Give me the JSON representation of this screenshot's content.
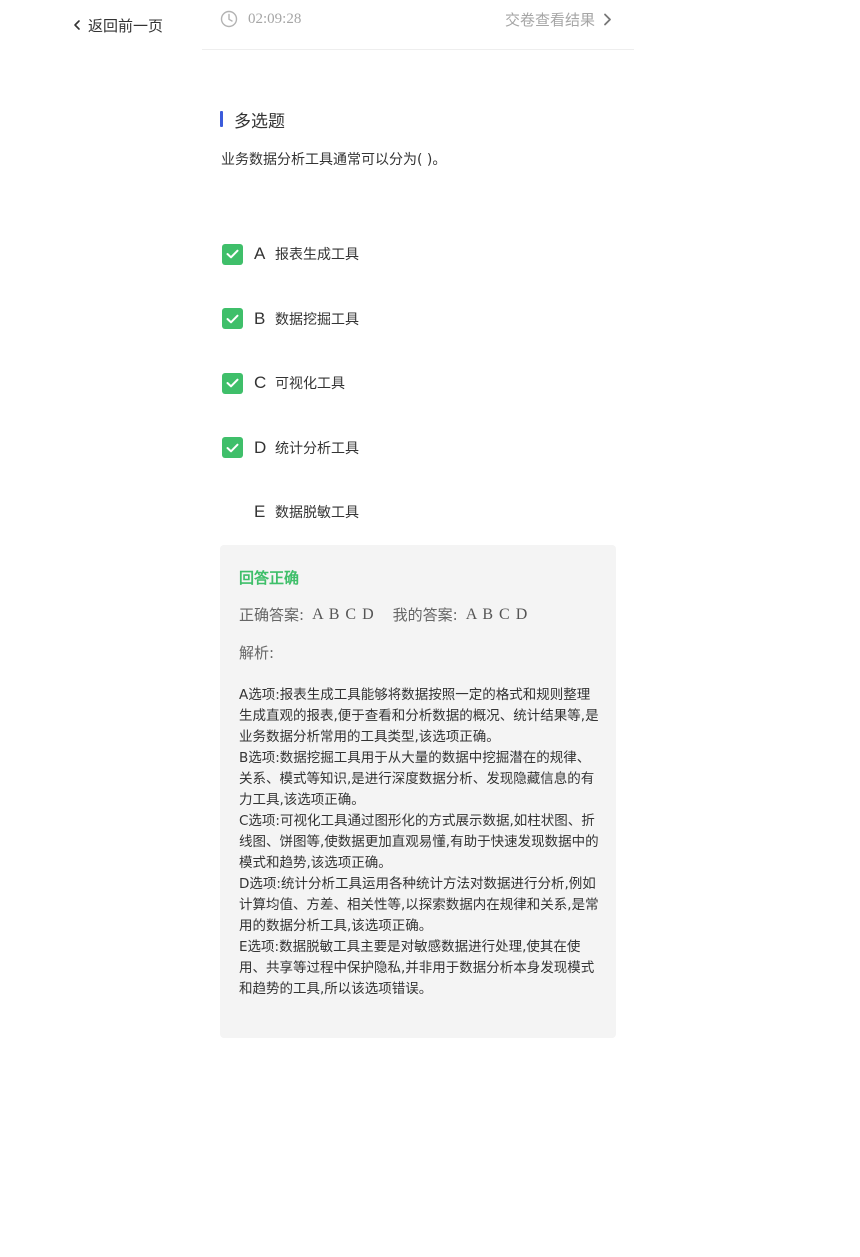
{
  "nav": {
    "back_label": "返回前一页"
  },
  "header": {
    "timer": "02:09:28",
    "submit_label": "交卷查看结果"
  },
  "question": {
    "type": "多选题",
    "text": "业务数据分析工具通常可以分为( )。",
    "options": [
      {
        "letter": "A",
        "text": "报表生成工具",
        "checked": true
      },
      {
        "letter": "B",
        "text": "数据挖掘工具",
        "checked": true
      },
      {
        "letter": "C",
        "text": "可视化工具",
        "checked": true
      },
      {
        "letter": "D",
        "text": "统计分析工具",
        "checked": true
      },
      {
        "letter": "E",
        "text": "数据脱敏工具",
        "checked": false
      }
    ]
  },
  "result": {
    "status": "回答正确",
    "correct_label": "正确答案:",
    "correct_value": "A B C D",
    "mine_label": "我的答案:",
    "mine_value": "A B C D",
    "analysis_label": "解析:",
    "analysis": [
      "A选项:报表生成工具能够将数据按照一定的格式和规则整理生成直观的报表,便于查看和分析数据的概况、统计结果等,是业务数据分析常用的工具类型,该选项正确。",
      "B选项:数据挖掘工具用于从大量的数据中挖掘潜在的规律、关系、模式等知识,是进行深度数据分析、发现隐藏信息的有力工具,该选项正确。",
      "C选项:可视化工具通过图形化的方式展示数据,如柱状图、折线图、饼图等,使数据更加直观易懂,有助于快速发现数据中的模式和趋势,该选项正确。",
      "D选项:统计分析工具运用各种统计方法对数据进行分析,例如计算均值、方差、相关性等,以探索数据内在规律和关系,是常用的数据分析工具,该选项正确。",
      "E选项:数据脱敏工具主要是对敏感数据进行处理,使其在使用、共享等过程中保护隐私,并非用于数据分析本身发现模式和趋势的工具,所以该选项错误。"
    ]
  },
  "colors": {
    "accent": "#3b5bdb",
    "success": "#3fbf6a",
    "muted": "#a6a6a6",
    "panel": "#f4f4f4"
  },
  "icons": {
    "back": "chevron-left-icon",
    "timer": "clock-icon",
    "submit": "chevron-right-icon",
    "checked": "check-icon"
  }
}
